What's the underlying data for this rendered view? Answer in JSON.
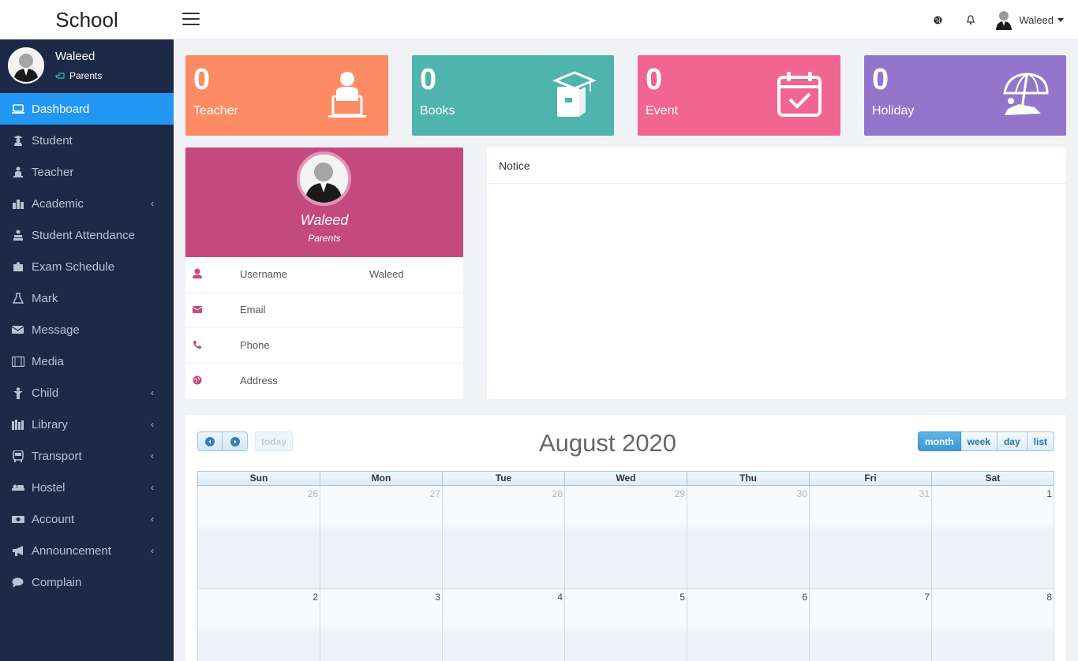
{
  "header": {
    "brand": "School",
    "user_name": "Waleed"
  },
  "sidebar": {
    "user": {
      "name": "Waleed",
      "role": "Parents"
    },
    "items": [
      {
        "label": "Dashboard",
        "icon": "laptop-icon",
        "active": true,
        "submenu": false
      },
      {
        "label": "Student",
        "icon": "student-icon",
        "submenu": false
      },
      {
        "label": "Teacher",
        "icon": "teacher-icon",
        "submenu": false
      },
      {
        "label": "Academic",
        "icon": "academic-icon",
        "submenu": true
      },
      {
        "label": "Student Attendance",
        "icon": "attendance-icon",
        "submenu": false
      },
      {
        "label": "Exam Schedule",
        "icon": "puzzle-icon",
        "submenu": false
      },
      {
        "label": "Mark",
        "icon": "flask-icon",
        "submenu": false
      },
      {
        "label": "Message",
        "icon": "envelope-icon",
        "submenu": false
      },
      {
        "label": "Media",
        "icon": "film-icon",
        "submenu": false
      },
      {
        "label": "Child",
        "icon": "child-icon",
        "submenu": true
      },
      {
        "label": "Library",
        "icon": "library-icon",
        "submenu": true
      },
      {
        "label": "Transport",
        "icon": "bus-icon",
        "submenu": true
      },
      {
        "label": "Hostel",
        "icon": "bed-icon",
        "submenu": true
      },
      {
        "label": "Account",
        "icon": "money-icon",
        "submenu": true
      },
      {
        "label": "Announcement",
        "icon": "megaphone-icon",
        "submenu": true
      },
      {
        "label": "Complain",
        "icon": "comment-icon",
        "submenu": false
      }
    ]
  },
  "stats": [
    {
      "value": "0",
      "label": "Teacher",
      "color": "#fe8b64",
      "icon": "teacher-laptop-icon"
    },
    {
      "value": "0",
      "label": "Books",
      "color": "#4fb4ac",
      "icon": "graduation-book-icon"
    },
    {
      "value": "0",
      "label": "Event",
      "color": "#f16593",
      "icon": "calendar-check-icon"
    },
    {
      "value": "0",
      "label": "Holiday",
      "color": "#9376cc",
      "icon": "beach-umbrella-icon"
    }
  ],
  "profile": {
    "name": "Waleed",
    "role": "Parents",
    "rows": [
      {
        "key": "Username",
        "value": "Waleed",
        "icon": "user-icon"
      },
      {
        "key": "Email",
        "value": "",
        "icon": "envelope-icon"
      },
      {
        "key": "Phone",
        "value": "",
        "icon": "phone-icon"
      },
      {
        "key": "Address",
        "value": "",
        "icon": "globe-icon"
      }
    ]
  },
  "notice": {
    "title": "Notice"
  },
  "calendar": {
    "title": "August 2020",
    "today_label": "today",
    "views": [
      "month",
      "week",
      "day",
      "list"
    ],
    "days_of_week": [
      "Sun",
      "Mon",
      "Tue",
      "Wed",
      "Thu",
      "Fri",
      "Sat"
    ],
    "weeks": [
      [
        "26",
        "27",
        "28",
        "29",
        "30",
        "31",
        "1"
      ],
      [
        "2",
        "3",
        "4",
        "5",
        "6",
        "7",
        "8"
      ]
    ],
    "other_month_first_week": 6
  },
  "colors": {
    "sidebar_bg": "#1c2a48",
    "active_nav": "#2196f3",
    "profile_head": "#c3497f"
  }
}
